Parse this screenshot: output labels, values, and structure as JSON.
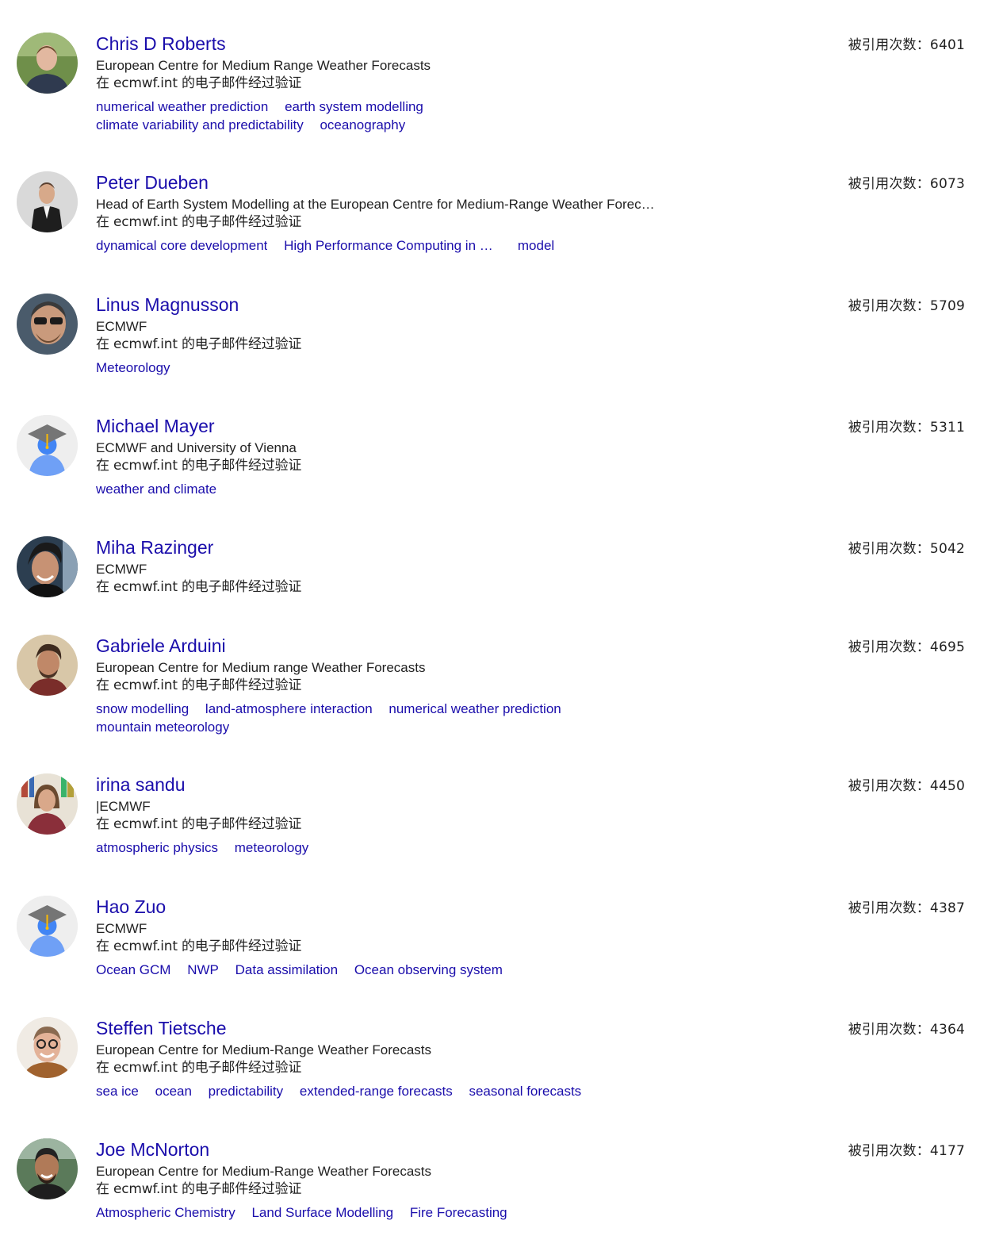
{
  "profiles": [
    {
      "name": "Chris D Roberts",
      "affiliation": "European Centre for Medium Range Weather Forecasts",
      "email": "在 ecmwf.int 的电子邮件经过验证",
      "cited_by": "被引用次数：6401",
      "avatar": "photo-avatar",
      "interests": [
        "numerical weather prediction",
        "earth system modelling",
        "climate variability and predictability",
        "oceanography"
      ]
    },
    {
      "name": "Peter Dueben",
      "affiliation": "Head of Earth System Modelling at the European Centre for Medium-Range Weather Forecasts",
      "email": "在 ecmwf.int 的电子邮件经过验证",
      "cited_by": "被引用次数：6073",
      "avatar": "photo-avatar",
      "interests": [
        "dynamical core development",
        "High Performance Computing in weather and climate",
        "model"
      ]
    },
    {
      "name": "Linus Magnusson",
      "affiliation": "ECMWF",
      "email": "在 ecmwf.int 的电子邮件经过验证",
      "cited_by": "被引用次数：5709",
      "avatar": "photo-avatar",
      "interests": [
        "Meteorology"
      ]
    },
    {
      "name": "Michael Mayer",
      "affiliation": "ECMWF and University of Vienna",
      "email": "在 ecmwf.int 的电子邮件经过验证",
      "cited_by": "被引用次数：5311",
      "avatar": "default-avatar",
      "interests": [
        "weather and climate"
      ]
    },
    {
      "name": "Miha Razinger",
      "affiliation": "ECMWF",
      "email": "在 ecmwf.int 的电子邮件经过验证",
      "cited_by": "被引用次数：5042",
      "avatar": "photo-avatar",
      "interests": []
    },
    {
      "name": "Gabriele Arduini",
      "affiliation": "European Centre for Medium range Weather Forecasts",
      "email": "在 ecmwf.int 的电子邮件经过验证",
      "cited_by": "被引用次数：4695",
      "avatar": "photo-avatar",
      "interests": [
        "snow modelling",
        "land-atmosphere interaction",
        "numerical weather prediction",
        "mountain meteorology"
      ]
    },
    {
      "name": "irina sandu",
      "affiliation": "|ECMWF",
      "email": "在 ecmwf.int 的电子邮件经过验证",
      "cited_by": "被引用次数：4450",
      "avatar": "photo-avatar",
      "interests": [
        "atmospheric physics",
        "meteorology"
      ]
    },
    {
      "name": "Hao Zuo",
      "affiliation": "ECMWF",
      "email": "在 ecmwf.int 的电子邮件经过验证",
      "cited_by": "被引用次数：4387",
      "avatar": "default-avatar",
      "interests": [
        "Ocean GCM",
        "NWP",
        "Data assimilation",
        "Ocean observing system"
      ]
    },
    {
      "name": "Steffen Tietsche",
      "affiliation": "European Centre for Medium-Range Weather Forecasts",
      "email": "在 ecmwf.int 的电子邮件经过验证",
      "cited_by": "被引用次数：4364",
      "avatar": "photo-avatar",
      "interests": [
        "sea ice",
        "ocean",
        "predictability",
        "extended-range forecasts",
        "seasonal forecasts"
      ]
    },
    {
      "name": "Joe McNorton",
      "affiliation": "European Centre for Medium-Range Weather Forecasts",
      "email": "在 ecmwf.int 的电子邮件经过验证",
      "cited_by": "被引用次数：4177",
      "avatar": "photo-avatar",
      "interests": [
        "Atmospheric Chemistry",
        "Land Surface Modelling",
        "Fire Forecasting"
      ]
    }
  ],
  "colors": {
    "link": "#1a0dab",
    "text": "#222222"
  }
}
